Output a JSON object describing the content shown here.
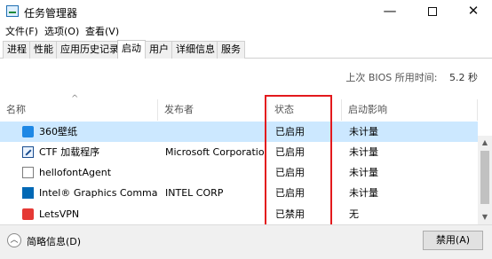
{
  "window": {
    "title": "任务管理器",
    "controls": {
      "minimize": "—",
      "close": "✕"
    }
  },
  "menu": [
    "文件(F)",
    "选项(O)",
    "查看(V)"
  ],
  "tabs": [
    "进程",
    "性能",
    "应用历史记录",
    "启动",
    "用户",
    "详细信息",
    "服务"
  ],
  "active_tab": "启动",
  "bios": {
    "label": "上次 BIOS 所用时间:",
    "value": "5.2 秒"
  },
  "columns": [
    "名称",
    "发布者",
    "状态",
    "启动影响"
  ],
  "rows": [
    {
      "name": "360壁纸",
      "publisher": "",
      "status": "已启用",
      "impact": "未计量",
      "icon": "360-icon",
      "selected": true
    },
    {
      "name": "CTF 加载程序",
      "publisher": "Microsoft Corporation",
      "status": "已启用",
      "impact": "未计量",
      "icon": "ctf-loader-icon"
    },
    {
      "name": "hellofontAgent",
      "publisher": "",
      "status": "已启用",
      "impact": "未计量",
      "icon": "app-icon"
    },
    {
      "name": "Intel® Graphics Comman...",
      "publisher": "INTEL CORP",
      "status": "已启用",
      "impact": "未计量",
      "icon": "intel-icon"
    },
    {
      "name": "LetsVPN",
      "publisher": "",
      "status": "已禁用",
      "impact": "无",
      "icon": "letsvpn-icon"
    }
  ],
  "footer": {
    "collapse_label": "简略信息(D)",
    "disable_button": "禁用(A)"
  },
  "colors": {
    "selected_row": "#cce8ff",
    "annotation_box": "#e3191d",
    "footer_bg": "#f0f0f0"
  }
}
